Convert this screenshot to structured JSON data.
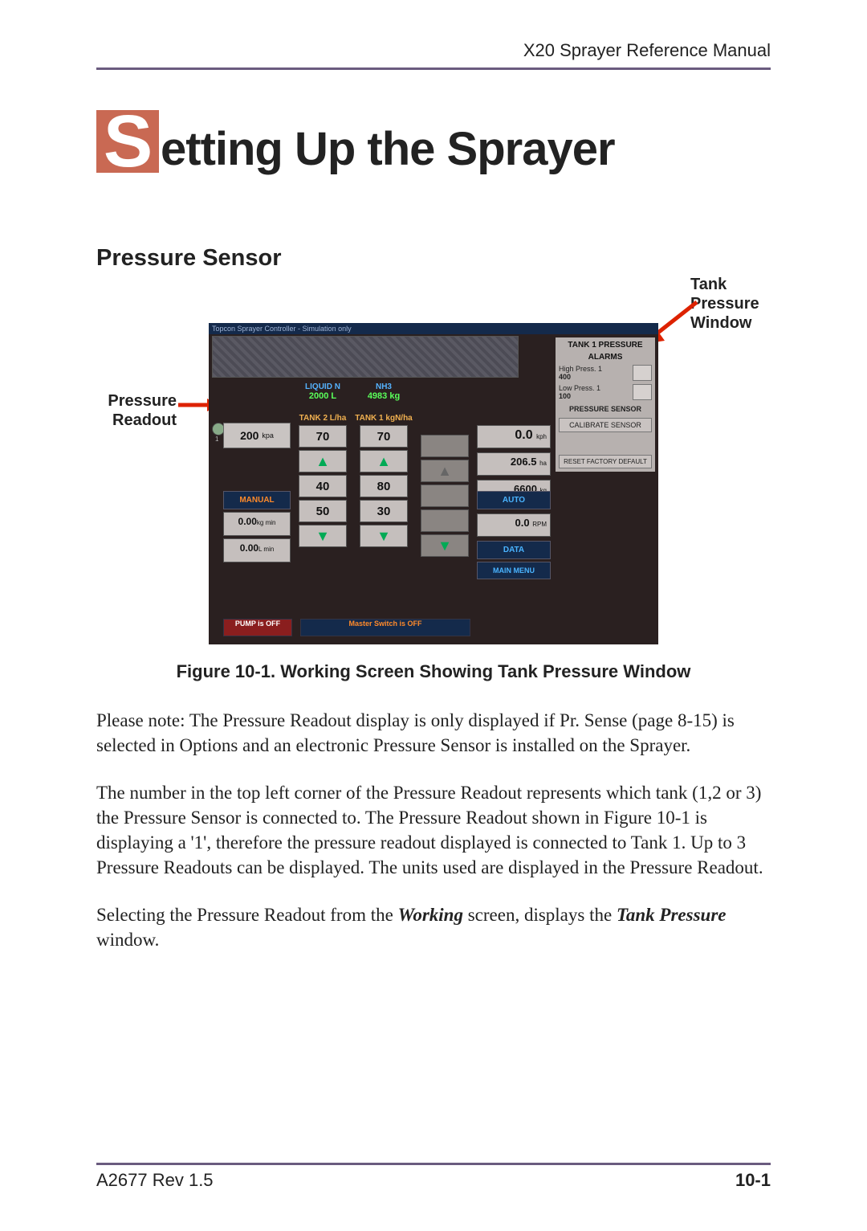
{
  "header": {
    "title": "X20 Sprayer Reference Manual"
  },
  "chapter": {
    "dropcap": "S",
    "rest": "etting Up the Sprayer"
  },
  "section": {
    "title": "Pressure Sensor"
  },
  "figure": {
    "callout_left": "Pressure Readout",
    "callout_right": "Tank Pressure Window",
    "caption": "Figure 10-1. Working Screen Showing Tank Pressure Window",
    "screenshot": {
      "title_bar": "Topcon Sprayer Controller - Simulation only",
      "pressure_readout": {
        "value": "200",
        "unit": "kpa",
        "tank_index": "1"
      },
      "column1": {
        "label_a": "LIQUID N",
        "label_b": "2000 L",
        "rate_label": "TANK 2\nL/ha",
        "rate_value": "70",
        "inc_values": [
          "40",
          "50"
        ]
      },
      "column2": {
        "label_a": "NH3",
        "label_b": "4983 kg",
        "rate_label": "TANK 1\nkgN/ha",
        "rate_value": "70",
        "inc_values": [
          "80",
          "30"
        ]
      },
      "right_readouts": {
        "top": "0.0",
        "top_unit": "kph",
        "mid": "206.5",
        "mid_unit": "ha",
        "bot": "6600",
        "bot_unit": "kg"
      },
      "left_small_reads": {
        "a": "0.00",
        "a_unit": "kg\nmin",
        "b": "0.00",
        "b_unit": "L\nmin"
      },
      "right_rpm": {
        "value": "0.0",
        "unit": "RPM"
      },
      "buttons": {
        "manual": "MANUAL",
        "auto": "AUTO",
        "data": "DATA",
        "main_menu": "MAIN MENU"
      },
      "status": {
        "pump": "PUMP is OFF",
        "master": "Master Switch is OFF"
      },
      "sidebar": {
        "title_a": "TANK 1 PRESSURE",
        "title_b": "ALARMS",
        "high_label": "High Press. 1",
        "high_value": "400",
        "low_label": "Low Press. 1",
        "low_value": "100",
        "ps_label": "PRESSURE SENSOR",
        "calibrate": "CALIBRATE SENSOR",
        "reset": "RESET FACTORY DEFAULT"
      }
    }
  },
  "body": {
    "p1": "Please note: The Pressure Readout display is only displayed if Pr. Sense (page 8-15) is selected in Options and an electronic Pressure Sensor is installed on the Sprayer.",
    "p2": "The number in the top left corner of the Pressure Readout represents which tank (1,2 or 3) the Pressure Sensor is connected to. The Pressure Readout shown in Figure 10-1 is displaying a '1', therefore the pressure readout displayed is connected to Tank 1. Up to 3 Pressure Readouts can be displayed. The units used are displayed in the Pressure Readout.",
    "p3_a": "Selecting the Pressure Readout from the ",
    "p3_em1": "Working",
    "p3_b": " screen, displays the ",
    "p3_em2": "Tank Pressure",
    "p3_c": " window."
  },
  "footer": {
    "left": "A2677 Rev 1.5",
    "page": "10-1"
  }
}
